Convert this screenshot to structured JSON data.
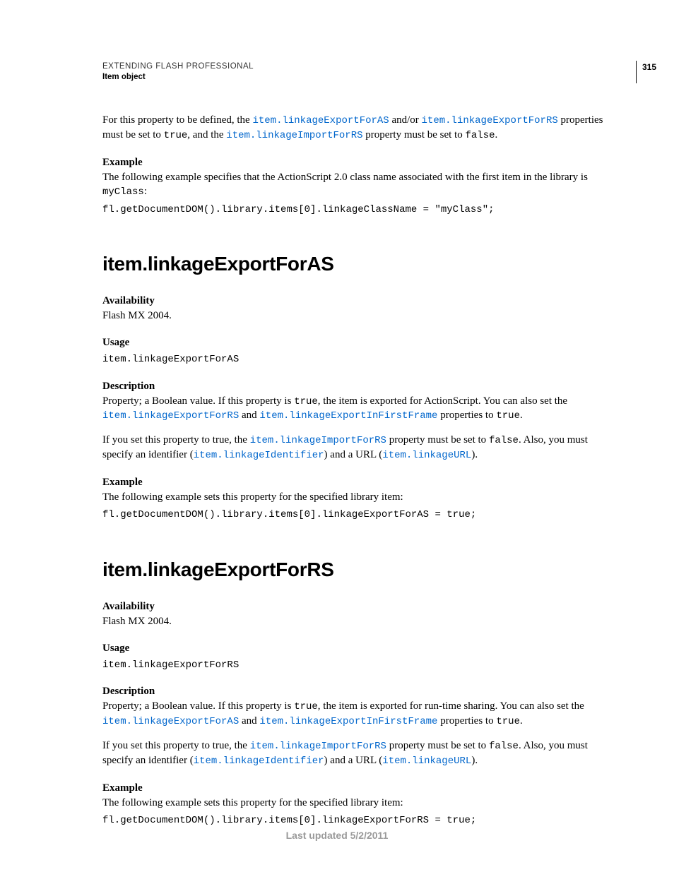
{
  "header": {
    "title": "EXTENDING FLASH PROFESSIONAL",
    "section": "Item object",
    "page_number": "315"
  },
  "intro": {
    "p1_pre": "For this property to be defined, the ",
    "link1": "item.linkageExportForAS",
    "p1_mid": " and/or ",
    "link2": "item.linkageExportForRS",
    "p1_post": " properties must be set to ",
    "true": "true",
    "p1_and": ", and the ",
    "link3": "item.linkageImportForRS",
    "p1_end": " property must be set to ",
    "false": "false",
    "period": "."
  },
  "intro_example": {
    "label": "Example",
    "text_pre": "The following example specifies that the ActionScript 2.0 class name associated with the first item in the library is ",
    "class_name": "myClass",
    "colon": ":",
    "code": "fl.getDocumentDOM().library.items[0].linkageClassName = \"myClass\";"
  },
  "s1": {
    "heading": "item.linkageExportForAS",
    "avail_label": "Availability",
    "avail_text": "Flash MX 2004.",
    "usage_label": "Usage",
    "usage_code": "item.linkageExportForAS",
    "desc_label": "Description",
    "desc_p1_a": "Property; a Boolean value. If this property is ",
    "desc_true": "true",
    "desc_p1_b": ", the item is exported for ActionScript. You can also set the ",
    "desc_link1": "item.linkageExportForRS",
    "desc_and": " and ",
    "desc_link2": "item.linkageExportInFirstFrame",
    "desc_p1_c": " properties to ",
    "desc_p1_end": ".",
    "desc_p2_a": "If you set this property to true, the ",
    "desc_p2_link1": "item.linkageImportForRS",
    "desc_p2_b": " property must be set to ",
    "desc_false": "false",
    "desc_p2_c": ". Also, you must specify an identifier (",
    "desc_p2_link2": "item.linkageIdentifier",
    "desc_p2_d": ") and a URL (",
    "desc_p2_link3": "item.linkageURL",
    "desc_p2_e": ").",
    "ex_label": "Example",
    "ex_text": "The following example sets this property for the specified library item:",
    "ex_code": "fl.getDocumentDOM().library.items[0].linkageExportForAS = true;"
  },
  "s2": {
    "heading": "item.linkageExportForRS",
    "avail_label": "Availability",
    "avail_text": "Flash MX 2004.",
    "usage_label": "Usage",
    "usage_code": "item.linkageExportForRS",
    "desc_label": "Description",
    "desc_p1_a": "Property; a Boolean value. If this property is ",
    "desc_true": "true",
    "desc_p1_b": ", the item is exported for run-time sharing. You can also set the ",
    "desc_link1": "item.linkageExportForAS",
    "desc_and": " and ",
    "desc_link2": "item.linkageExportInFirstFrame",
    "desc_p1_c": " properties to ",
    "desc_p1_end": ".",
    "desc_p2_a": "If you set this property to true, the ",
    "desc_p2_link1": "item.linkageImportForRS",
    "desc_p2_b": " property must be set to ",
    "desc_false": "false",
    "desc_p2_c": ". Also, you must specify an identifier (",
    "desc_p2_link2": "item.linkageIdentifier",
    "desc_p2_d": ") and a URL (",
    "desc_p2_link3": "item.linkageURL",
    "desc_p2_e": ").",
    "ex_label": "Example",
    "ex_text": "The following example sets this property for the specified library item:",
    "ex_code": "fl.getDocumentDOM().library.items[0].linkageExportForRS = true;"
  },
  "footer": {
    "text": "Last updated 5/2/2011"
  }
}
